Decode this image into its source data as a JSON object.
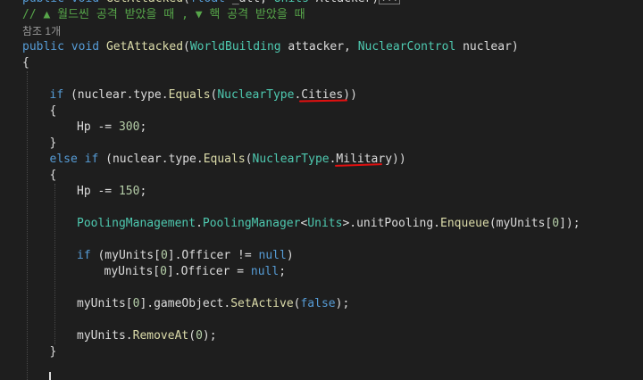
{
  "editor": {
    "lines": [
      {
        "indent": 0,
        "tokens": [
          {
            "t": "public",
            "c": "kw"
          },
          {
            "t": " ",
            "c": "pl"
          },
          {
            "t": "void",
            "c": "kw"
          },
          {
            "t": " ",
            "c": "pl"
          },
          {
            "t": "GetAttacked",
            "c": "fn"
          },
          {
            "t": "(",
            "c": "pl"
          },
          {
            "t": "float",
            "c": "kw"
          },
          {
            "t": " _att, ",
            "c": "pl"
          },
          {
            "t": "Units",
            "c": "ty"
          },
          {
            "t": " Attacker)",
            "c": "pl"
          }
        ],
        "collapsed": "..."
      },
      {
        "indent": 0,
        "tokens": [
          {
            "t": "// ▲ 월드씬 공격 받았을 때 , ▼ 핵 공격 받았을 때",
            "c": "cm"
          }
        ]
      },
      {
        "indent": 0,
        "codelens": "참조 1개"
      },
      {
        "indent": 0,
        "tokens": [
          {
            "t": "public",
            "c": "kw"
          },
          {
            "t": " ",
            "c": "pl"
          },
          {
            "t": "void",
            "c": "kw"
          },
          {
            "t": " ",
            "c": "pl"
          },
          {
            "t": "GetAttacked",
            "c": "fn"
          },
          {
            "t": "(",
            "c": "pl"
          },
          {
            "t": "WorldBuilding",
            "c": "ty"
          },
          {
            "t": " attacker, ",
            "c": "pl"
          },
          {
            "t": "NuclearControl",
            "c": "ty"
          },
          {
            "t": " nuclear)",
            "c": "pl"
          }
        ]
      },
      {
        "indent": 0,
        "tokens": [
          {
            "t": "{",
            "c": "pl"
          }
        ]
      },
      {
        "indent": 0,
        "tokens": []
      },
      {
        "indent": 1,
        "tokens": [
          {
            "t": "if",
            "c": "kw"
          },
          {
            "t": " (nuclear.type.",
            "c": "pl"
          },
          {
            "t": "Equals",
            "c": "fn"
          },
          {
            "t": "(",
            "c": "pl"
          },
          {
            "t": "NuclearType",
            "c": "ty"
          },
          {
            "t": ".Cities))",
            "c": "pl"
          }
        ]
      },
      {
        "indent": 1,
        "tokens": [
          {
            "t": "{",
            "c": "pl"
          }
        ]
      },
      {
        "indent": 2,
        "tokens": [
          {
            "t": "Hp -= ",
            "c": "pl"
          },
          {
            "t": "300",
            "c": "nm"
          },
          {
            "t": ";",
            "c": "pl"
          }
        ]
      },
      {
        "indent": 1,
        "tokens": [
          {
            "t": "}",
            "c": "pl"
          }
        ]
      },
      {
        "indent": 1,
        "tokens": [
          {
            "t": "else",
            "c": "kw"
          },
          {
            "t": " ",
            "c": "pl"
          },
          {
            "t": "if",
            "c": "kw"
          },
          {
            "t": " (nuclear.type.",
            "c": "pl"
          },
          {
            "t": "Equals",
            "c": "fn"
          },
          {
            "t": "(",
            "c": "pl"
          },
          {
            "t": "NuclearType",
            "c": "ty"
          },
          {
            "t": ".Military))",
            "c": "pl"
          }
        ]
      },
      {
        "indent": 1,
        "tokens": [
          {
            "t": "{",
            "c": "pl"
          }
        ]
      },
      {
        "indent": 2,
        "tokens": [
          {
            "t": "Hp -= ",
            "c": "pl"
          },
          {
            "t": "150",
            "c": "nm"
          },
          {
            "t": ";",
            "c": "pl"
          }
        ]
      },
      {
        "indent": 2,
        "tokens": []
      },
      {
        "indent": 2,
        "tokens": [
          {
            "t": "PoolingManagement",
            "c": "ty"
          },
          {
            "t": ".",
            "c": "pl"
          },
          {
            "t": "PoolingManager",
            "c": "ty"
          },
          {
            "t": "<",
            "c": "pl"
          },
          {
            "t": "Units",
            "c": "ty"
          },
          {
            "t": ">.unitPooling.",
            "c": "pl"
          },
          {
            "t": "Enqueue",
            "c": "fn"
          },
          {
            "t": "(myUnits[",
            "c": "pl"
          },
          {
            "t": "0",
            "c": "nm"
          },
          {
            "t": "]);",
            "c": "pl"
          }
        ]
      },
      {
        "indent": 2,
        "tokens": []
      },
      {
        "indent": 2,
        "tokens": [
          {
            "t": "if",
            "c": "kw"
          },
          {
            "t": " (myUnits[",
            "c": "pl"
          },
          {
            "t": "0",
            "c": "nm"
          },
          {
            "t": "].Officer != ",
            "c": "pl"
          },
          {
            "t": "null",
            "c": "kw"
          },
          {
            "t": ")",
            "c": "pl"
          }
        ]
      },
      {
        "indent": 3,
        "tokens": [
          {
            "t": "myUnits[",
            "c": "pl"
          },
          {
            "t": "0",
            "c": "nm"
          },
          {
            "t": "].Officer = ",
            "c": "pl"
          },
          {
            "t": "null",
            "c": "kw"
          },
          {
            "t": ";",
            "c": "pl"
          }
        ]
      },
      {
        "indent": 2,
        "tokens": []
      },
      {
        "indent": 2,
        "tokens": [
          {
            "t": "myUnits[",
            "c": "pl"
          },
          {
            "t": "0",
            "c": "nm"
          },
          {
            "t": "].gameObject.",
            "c": "pl"
          },
          {
            "t": "SetActive",
            "c": "fn"
          },
          {
            "t": "(",
            "c": "pl"
          },
          {
            "t": "false",
            "c": "kw"
          },
          {
            "t": ");",
            "c": "pl"
          }
        ]
      },
      {
        "indent": 2,
        "tokens": []
      },
      {
        "indent": 2,
        "tokens": [
          {
            "t": "myUnits.",
            "c": "pl"
          },
          {
            "t": "RemoveAt",
            "c": "fn"
          },
          {
            "t": "(",
            "c": "pl"
          },
          {
            "t": "0",
            "c": "nm"
          },
          {
            "t": ");",
            "c": "pl"
          }
        ]
      },
      {
        "indent": 1,
        "tokens": [
          {
            "t": "}",
            "c": "pl"
          }
        ]
      }
    ],
    "colors": {
      "background": "#1e1e1e",
      "keyword": "#569cd6",
      "type": "#4ec9b0",
      "method": "#dcdcaa",
      "number": "#b5cea8",
      "plain": "#dcdcdc",
      "comment": "#57a64a",
      "annotation_underline": "#e01010"
    },
    "annotations": [
      {
        "label": "underline-Cities",
        "line": 6,
        "target": "Cities"
      },
      {
        "label": "underline-Military",
        "line": 10,
        "target": "Military"
      }
    ]
  }
}
